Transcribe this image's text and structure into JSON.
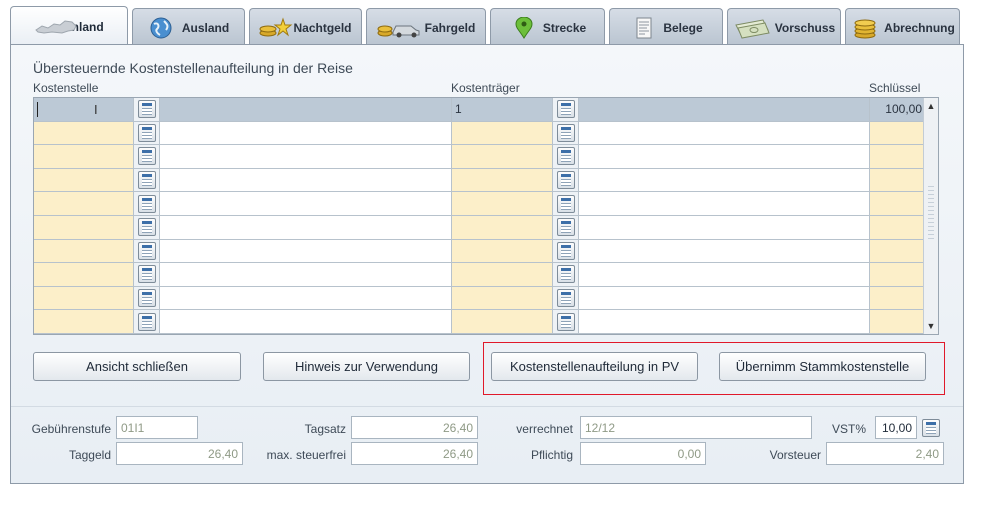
{
  "tabs": [
    {
      "label": "Inland",
      "icon": "austria-map-icon",
      "active": true
    },
    {
      "label": "Ausland",
      "icon": "globe-icon",
      "active": false
    },
    {
      "label": "Nachtgeld",
      "icon": "coins-stars-icon",
      "active": false
    },
    {
      "label": "Fahrgeld",
      "icon": "car-coins-icon",
      "active": false
    },
    {
      "label": "Strecke",
      "icon": "map-pin-icon",
      "active": false
    },
    {
      "label": "Belege",
      "icon": "receipt-icon",
      "active": false
    },
    {
      "label": "Vorschuss",
      "icon": "banknotes-icon",
      "active": false
    },
    {
      "label": "Abrechnung",
      "icon": "coin-stack-icon",
      "active": false
    }
  ],
  "section_title": "Übersteuernde Kostenstellenaufteilung in der Reise",
  "columns": {
    "kostenstelle": "Kostenstelle",
    "kostentraeger": "Kostenträger",
    "schluessel": "Schlüssel"
  },
  "rows": [
    {
      "kostenstelle": "",
      "kostentraeger": "1",
      "schluessel": "100,00"
    },
    {
      "kostenstelle": "",
      "kostentraeger": "",
      "schluessel": ""
    },
    {
      "kostenstelle": "",
      "kostentraeger": "",
      "schluessel": ""
    },
    {
      "kostenstelle": "",
      "kostentraeger": "",
      "schluessel": ""
    },
    {
      "kostenstelle": "",
      "kostentraeger": "",
      "schluessel": ""
    },
    {
      "kostenstelle": "",
      "kostentraeger": "",
      "schluessel": ""
    },
    {
      "kostenstelle": "",
      "kostentraeger": "",
      "schluessel": ""
    },
    {
      "kostenstelle": "",
      "kostentraeger": "",
      "schluessel": ""
    },
    {
      "kostenstelle": "",
      "kostentraeger": "",
      "schluessel": ""
    },
    {
      "kostenstelle": "",
      "kostentraeger": "",
      "schluessel": ""
    }
  ],
  "buttons": {
    "close": "Ansicht schließen",
    "hint": "Hinweis zur Verwendung",
    "pv": "Kostenstellenaufteilung in PV",
    "master": "Übernimm Stammkostenstelle"
  },
  "footer": {
    "gebuehrenstufe_label": "Gebührenstufe",
    "gebuehrenstufe": "01I1",
    "tagsatz_label": "Tagsatz",
    "tagsatz": "26,40",
    "verrechnet_label": "verrechnet",
    "verrechnet": "12/12",
    "vst_label": "VST%",
    "vst": "10,00",
    "taggeld_label": "Taggeld",
    "taggeld": "26,40",
    "max_label": "max. steuerfrei",
    "max": "26,40",
    "pflichtig_label": "Pflichtig",
    "pflichtig": "0,00",
    "vorsteuer_label": "Vorsteuer",
    "vorsteuer": "2,40"
  },
  "colors": {
    "highlight_border": "#e0192a",
    "input_yellow": "#fcefc9",
    "selected_row": "#bcc9d6"
  }
}
